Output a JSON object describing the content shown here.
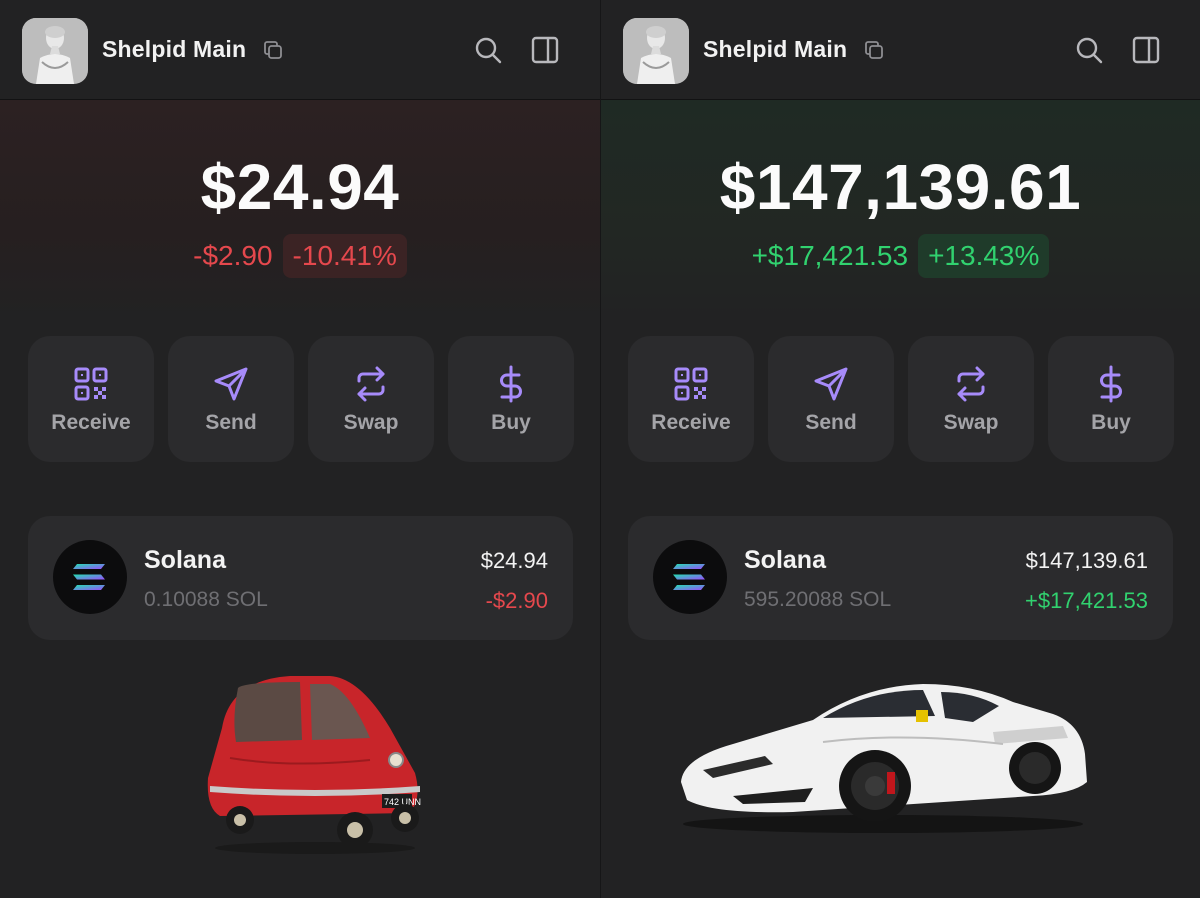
{
  "colors": {
    "negative": "#e5484d",
    "positive": "#31d26f",
    "accent": "#a78bfa"
  },
  "panels": [
    {
      "wallet_name": "Shelpid Main",
      "balance": "$24.94",
      "change_abs": "-$2.90",
      "change_pct": "-10.41%",
      "trend": "negative",
      "actions": [
        {
          "label": "Receive",
          "icon": "qr-code-icon"
        },
        {
          "label": "Send",
          "icon": "send-icon"
        },
        {
          "label": "Swap",
          "icon": "swap-icon"
        },
        {
          "label": "Buy",
          "icon": "dollar-icon"
        }
      ],
      "token": {
        "name": "Solana",
        "amount": "0.10088 SOL",
        "value": "$24.94",
        "change": "-$2.90"
      },
      "car_image": "red-microcar-image"
    },
    {
      "wallet_name": "Shelpid Main",
      "balance": "$147,139.61",
      "change_abs": "+$17,421.53",
      "change_pct": "+13.43%",
      "trend": "positive",
      "actions": [
        {
          "label": "Receive",
          "icon": "qr-code-icon"
        },
        {
          "label": "Send",
          "icon": "send-icon"
        },
        {
          "label": "Swap",
          "icon": "swap-icon"
        },
        {
          "label": "Buy",
          "icon": "dollar-icon"
        }
      ],
      "token": {
        "name": "Solana",
        "amount": "595.20088 SOL",
        "value": "$147,139.61",
        "change": "+$17,421.53"
      },
      "car_image": "white-supercar-image"
    }
  ]
}
